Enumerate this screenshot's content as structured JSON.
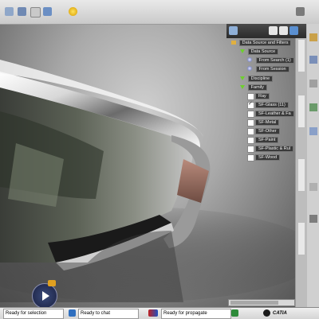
{
  "filter_panel": {
    "root_label": "Data Source and Filters",
    "data_source": {
      "label": "Data Source",
      "options": [
        "From Search (1)",
        "From Session"
      ]
    },
    "discipline": {
      "label": "Discipline"
    },
    "family": {
      "label": "Family",
      "items": [
        {
          "label": "Ray",
          "checked": false
        },
        {
          "label": "SF-Glass (11)",
          "checked": true
        },
        {
          "label": "SF-Leather & Fa",
          "checked": false
        },
        {
          "label": "SF-Metal",
          "checked": false
        },
        {
          "label": "SF-Other",
          "checked": false
        },
        {
          "label": "SF-Paint",
          "checked": false
        },
        {
          "label": "SF-Plastic & Rul",
          "checked": false
        },
        {
          "label": "SF-Wood",
          "checked": false
        }
      ]
    }
  },
  "status_bar": {
    "selection_status": "Ready for selection",
    "chat_status": "Ready to chat",
    "propagate_status": "Ready for propagate",
    "brand": "CATIA"
  },
  "icons": {
    "tree_filter": "funnel-icon",
    "compass": "compass-navigator-icon"
  }
}
